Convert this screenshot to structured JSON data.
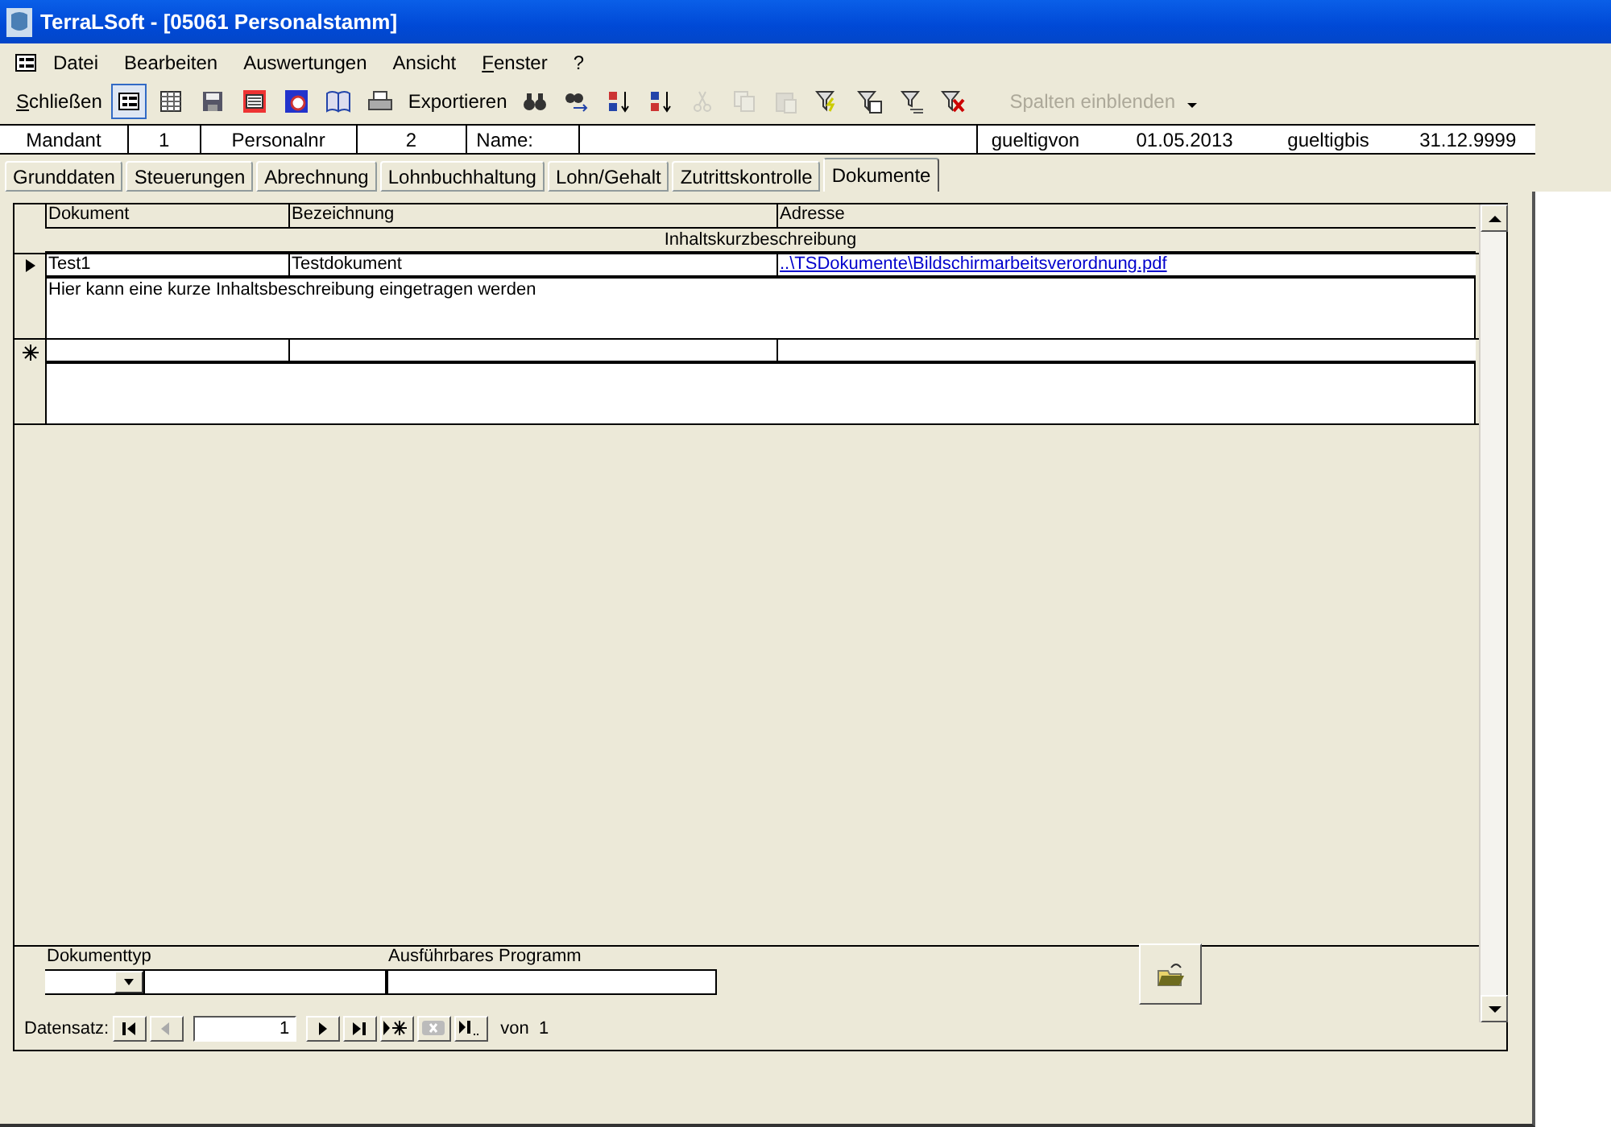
{
  "window": {
    "title": "TerraLSoft - [05061 Personalstamm]"
  },
  "menu": [
    {
      "label": "Datei",
      "underline_first": false
    },
    {
      "label": "Bearbeiten",
      "underline_first": false
    },
    {
      "label": "Auswertungen",
      "underline_first": false
    },
    {
      "label": "Ansicht",
      "underline_first": false
    },
    {
      "label": "Fenster",
      "underline_first": true
    },
    {
      "label": "?",
      "underline_first": false
    }
  ],
  "toolbar": [
    {
      "kind": "text",
      "label": "Schließen",
      "underline_first": true,
      "disabled": false
    },
    {
      "kind": "icon",
      "selected": true,
      "disabled": false
    },
    {
      "kind": "icon",
      "selected": false,
      "disabled": false
    },
    {
      "kind": "icon",
      "selected": false,
      "disabled": false
    },
    {
      "kind": "icon",
      "selected": false,
      "disabled": false
    },
    {
      "kind": "icon",
      "selected": false,
      "disabled": false
    },
    {
      "kind": "icon",
      "selected": false,
      "disabled": false
    },
    {
      "kind": "icon",
      "selected": false,
      "disabled": false
    },
    {
      "kind": "text",
      "label": "Exportieren",
      "underline_first": false,
      "disabled": false
    },
    {
      "kind": "icon",
      "selected": false,
      "disabled": false
    },
    {
      "kind": "icon",
      "selected": false,
      "disabled": false
    },
    {
      "kind": "icon",
      "selected": false,
      "disabled": false
    },
    {
      "kind": "icon",
      "selected": false,
      "disabled": false
    },
    {
      "kind": "icon",
      "selected": false,
      "disabled": true
    },
    {
      "kind": "icon",
      "selected": false,
      "disabled": true
    },
    {
      "kind": "icon",
      "selected": false,
      "disabled": true
    },
    {
      "kind": "icon",
      "selected": false,
      "disabled": false
    },
    {
      "kind": "icon",
      "selected": false,
      "disabled": false
    },
    {
      "kind": "icon",
      "selected": false,
      "disabled": false
    },
    {
      "kind": "icon",
      "selected": false,
      "disabled": false
    },
    {
      "kind": "dropdown",
      "label": "Spalten einblenden",
      "disabled": true
    }
  ],
  "header": {
    "mandant_label": "Mandant",
    "mandant": "1",
    "personalnr_label": "Personalnr",
    "personalnr": "2",
    "name_label": "Name:",
    "gueltigvon_label": "gueltigvon",
    "gueltigvon": "01.05.2013",
    "gueltigbis_label": "gueltigbis",
    "gueltigbis": "31.12.9999"
  },
  "tabs": [
    {
      "label": "Grunddaten",
      "selected": false
    },
    {
      "label": "Steuerungen",
      "selected": false
    },
    {
      "label": "Abrechnung",
      "selected": false
    },
    {
      "label": "Lohnbuchhaltung",
      "selected": false
    },
    {
      "label": "Lohn/Gehalt",
      "selected": false
    },
    {
      "label": "Zutrittskontrolle",
      "selected": false
    },
    {
      "label": "Dokumente",
      "selected": true
    }
  ],
  "grid": {
    "columns": [
      "Dokument",
      "Bezeichnung",
      "Adresse"
    ],
    "subheader": "Inhaltskurzbeschreibung",
    "rows": [
      {
        "kind": "current",
        "dokument": "Test1",
        "bezeichnung": "Testdokument",
        "adresse": "..\\TSDokumente\\Bildschirmarbeitsverordnung.pdf",
        "beschreibung": "Hier kann eine kurze Inhaltsbeschreibung eingetragen werden"
      },
      {
        "kind": "new"
      }
    ]
  },
  "detail": {
    "dokumenttyp_label": "Dokumenttyp",
    "programm_label": "Ausführbares Programm"
  },
  "navigator": {
    "label": "Datensatz:",
    "record": "1",
    "total": "von  1"
  }
}
